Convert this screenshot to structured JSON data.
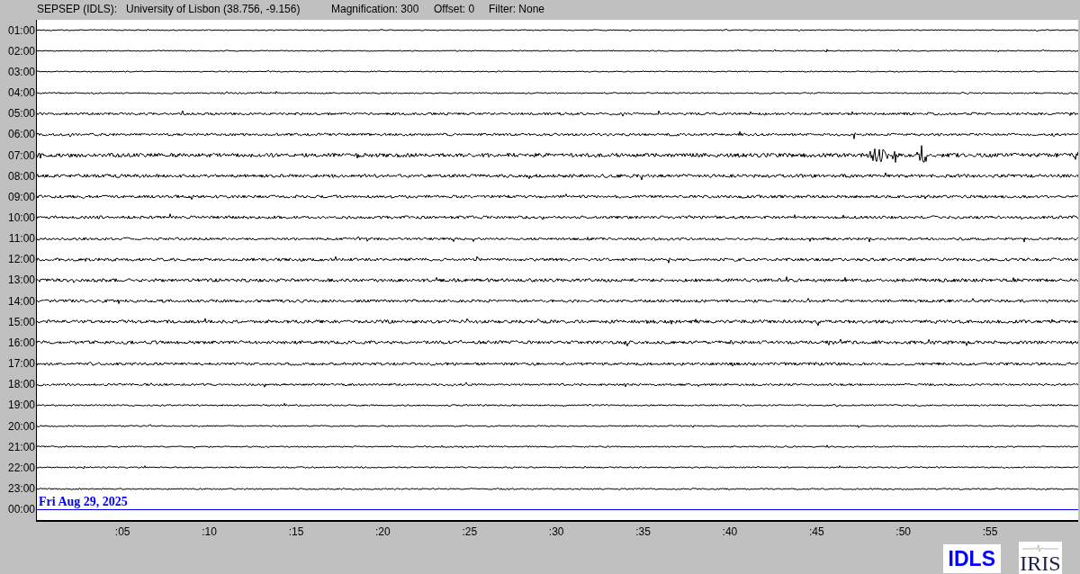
{
  "header": {
    "station": "SEPSEP (IDLS):",
    "location": "University of Lisbon (38.756, -9.156)",
    "magnification": "Magnification: 300",
    "offset": "Offset: 0",
    "filter": "Filter: None"
  },
  "rows": [
    {
      "label": "01:00",
      "current": false
    },
    {
      "label": "02:00",
      "current": false
    },
    {
      "label": "03:00",
      "current": false
    },
    {
      "label": "04:00",
      "current": false
    },
    {
      "label": "05:00",
      "current": false
    },
    {
      "label": "06:00",
      "current": false
    },
    {
      "label": "07:00",
      "current": false
    },
    {
      "label": "08:00",
      "current": false
    },
    {
      "label": "09:00",
      "current": false
    },
    {
      "label": "10:00",
      "current": false
    },
    {
      "label": "11:00",
      "current": false
    },
    {
      "label": "12:00",
      "current": false
    },
    {
      "label": "13:00",
      "current": false
    },
    {
      "label": "14:00",
      "current": false
    },
    {
      "label": "15:00",
      "current": false
    },
    {
      "label": "16:00",
      "current": false
    },
    {
      "label": "17:00",
      "current": false
    },
    {
      "label": "18:00",
      "current": false
    },
    {
      "label": "19:00",
      "current": false
    },
    {
      "label": "20:00",
      "current": false
    },
    {
      "label": "21:00",
      "current": false
    },
    {
      "label": "22:00",
      "current": false
    },
    {
      "label": "23:00",
      "current": false
    },
    {
      "label": "00:00",
      "current": true
    }
  ],
  "date": "Fri Aug 29, 2025",
  "minute_ticks": [
    ":05",
    ":10",
    ":15",
    ":20",
    ":25",
    ":30",
    ":35",
    ":40",
    ":45",
    ":50",
    ":55"
  ],
  "logos": {
    "station": "IDLS",
    "network": "IRIS"
  }
}
